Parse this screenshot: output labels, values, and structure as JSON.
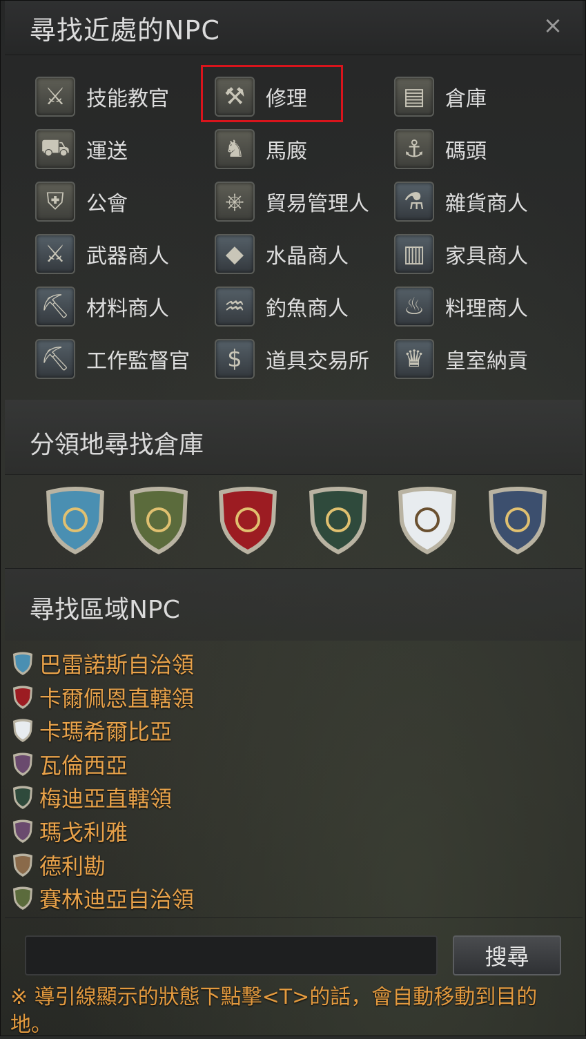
{
  "window": {
    "title": "尋找近處的NPC",
    "close_symbol": "×"
  },
  "npc_buttons": [
    {
      "label": "技能教官",
      "icon": "crossed-axes-icon",
      "glyph": "⚔"
    },
    {
      "label": "修理",
      "icon": "anvil-icon",
      "glyph": "⚒"
    },
    {
      "label": "倉庫",
      "icon": "chest-icon",
      "glyph": "▤"
    },
    {
      "label": "運送",
      "icon": "wagon-icon",
      "glyph": "⛟"
    },
    {
      "label": "馬廄",
      "icon": "horse-head-icon",
      "glyph": "♞"
    },
    {
      "label": "碼頭",
      "icon": "anchor-icon",
      "glyph": "⚓"
    },
    {
      "label": "公會",
      "icon": "shield-crest-icon",
      "glyph": "⛨"
    },
    {
      "label": "貿易管理人",
      "icon": "wheel-icon",
      "glyph": "⎈"
    },
    {
      "label": "雜貨商人",
      "icon": "potion-icon",
      "glyph": "⚗"
    },
    {
      "label": "武器商人",
      "icon": "sword-shield-icon",
      "glyph": "⚔"
    },
    {
      "label": "水晶商人",
      "icon": "diamond-icon",
      "glyph": "◆"
    },
    {
      "label": "家具商人",
      "icon": "armchair-icon",
      "glyph": "▥"
    },
    {
      "label": "材料商人",
      "icon": "pickaxe-icon",
      "glyph": "⛏"
    },
    {
      "label": "釣魚商人",
      "icon": "fish-icon",
      "glyph": "♒"
    },
    {
      "label": "料理商人",
      "icon": "roast-chicken-icon",
      "glyph": "♨"
    },
    {
      "label": "工作監督官",
      "icon": "pickaxe-icon",
      "glyph": "⛏"
    },
    {
      "label": "道具交易所",
      "icon": "money-bag-icon",
      "glyph": "$"
    },
    {
      "label": "皇室納貢",
      "icon": "cart-icon",
      "glyph": "♛"
    }
  ],
  "sections": {
    "storage_title": "分領地尋找倉庫",
    "region_title": "尋找區域NPC"
  },
  "crests": [
    {
      "name": "blue-horse-crest-icon",
      "color": "#4a8fb2"
    },
    {
      "name": "green-lion-crest-icon",
      "color": "#5b6b3c"
    },
    {
      "name": "red-eagle-crest-icon",
      "color": "#9c1c22"
    },
    {
      "name": "green-crescent-crest-icon",
      "color": "#2f4a3c"
    },
    {
      "name": "white-tree-crest-icon",
      "color": "#e8ecef"
    },
    {
      "name": "blue-red-knot-crest-icon",
      "color": "#3c4f6e"
    }
  ],
  "regions": [
    {
      "label": "巴雷諾斯自治領",
      "color": "#4a8fb2"
    },
    {
      "label": "卡爾佩恩直轄領",
      "color": "#9c1c22"
    },
    {
      "label": "卡瑪希爾比亞",
      "color": "#e8ecef"
    },
    {
      "label": "瓦倫西亞",
      "color": "#6a4a6e"
    },
    {
      "label": "梅迪亞直轄領",
      "color": "#2f4a3c"
    },
    {
      "label": "瑪戈利雅",
      "color": "#6a4a6e"
    },
    {
      "label": "德利勘",
      "color": "#8a6a4a"
    },
    {
      "label": "賽林迪亞自治領",
      "color": "#5b6b3c"
    }
  ],
  "search": {
    "input_value": "",
    "button_label": "搜尋"
  },
  "hint": "※ 導引線顯示的狀態下點擊<T>的話，會自動移動到目的地。"
}
